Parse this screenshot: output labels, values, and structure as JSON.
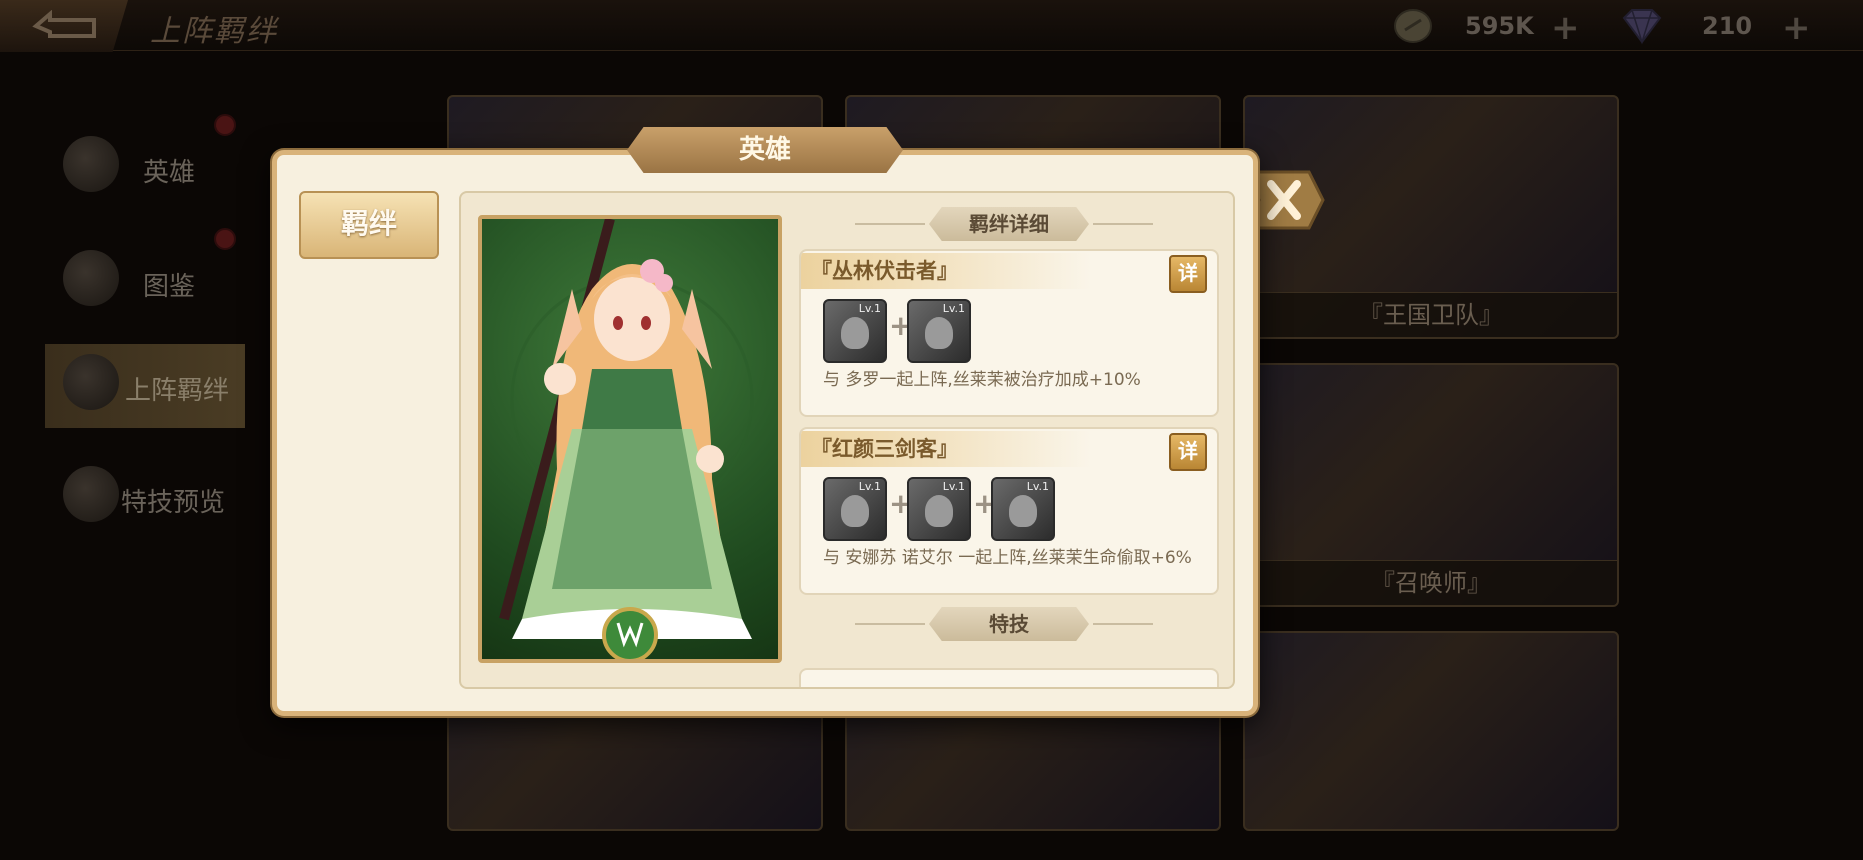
{
  "header": {
    "title": "上阵羁绊",
    "gold": {
      "value": "595K",
      "icon": "coin-icon"
    },
    "gems": {
      "value": "210",
      "icon": "diamond-icon"
    }
  },
  "sidebar": {
    "items": [
      {
        "label": "英雄",
        "icon": "helmet-icon"
      },
      {
        "label": "图鉴",
        "icon": "book-icon"
      },
      {
        "label": "上阵羁绊",
        "icon": "handshake-icon"
      },
      {
        "label": "特技预览",
        "icon": "sword-icon"
      }
    ]
  },
  "background_cards": [
    {
      "label": "『王国卫队』"
    },
    {
      "label": "『召唤师』"
    }
  ],
  "dialog": {
    "title": "英雄",
    "tab_label": "羁绊",
    "sections": {
      "bond_detail": "羁绊详细",
      "skill": "特技"
    },
    "bonds": [
      {
        "name": "『丛林伏击者』",
        "detail_label": "详",
        "heroes": [
          {
            "level": "Lv.1"
          },
          {
            "level": "Lv.1"
          }
        ],
        "description": "与 多罗一起上阵,丝莱茉被治疗加成+10%"
      },
      {
        "name": "『红颜三剑客』",
        "detail_label": "详",
        "heroes": [
          {
            "level": "Lv.1"
          },
          {
            "level": "Lv.1"
          },
          {
            "level": "Lv.1"
          }
        ],
        "description": "与 安娜苏 诺艾尔 一起上阵,丝莱茉生命偷取+6%"
      }
    ]
  },
  "colors": {
    "dialog_bg": "#f7f0df",
    "accent_gold": "#d9b37a",
    "detail_button": "#b98634"
  }
}
